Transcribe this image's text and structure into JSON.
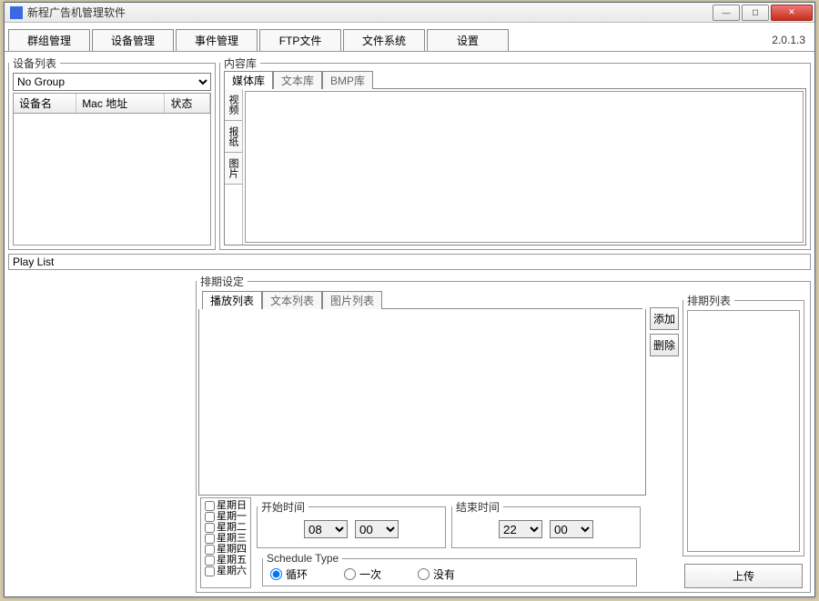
{
  "window": {
    "title": "新程广告机管理软件"
  },
  "version": "2.0.1.3",
  "main_tabs": [
    "群组管理",
    "设备管理",
    "事件管理",
    "FTP文件",
    "文件系统",
    "设置"
  ],
  "device_panel": {
    "legend": "设备列表",
    "group_selected": "No Group",
    "columns": {
      "name": "设备名",
      "mac": "Mac 地址",
      "state": "状态"
    }
  },
  "content_lib": {
    "legend": "内容库",
    "tabs": [
      "媒体库",
      "文本库",
      "BMP库"
    ],
    "vtabs": [
      "视频",
      "报纸",
      "图片"
    ]
  },
  "playlist_label": "Play List",
  "schedule": {
    "legend": "排期设定",
    "tabs": [
      "播放列表",
      "文本列表",
      "图片列表"
    ],
    "btn_add": "添加",
    "btn_del": "删除",
    "right_legend": "排期列表",
    "upload": "上传",
    "weekdays": [
      "星期日",
      "星期一",
      "星期二",
      "星期三",
      "星期四",
      "星期五",
      "星期六"
    ],
    "start_legend": "开始时间",
    "end_legend": "结束时间",
    "start_h": "08",
    "start_m": "00",
    "end_h": "22",
    "end_m": "00",
    "type_legend": "Schedule Type",
    "type_options": {
      "loop": "循环",
      "once": "一次",
      "none": "没有"
    }
  }
}
